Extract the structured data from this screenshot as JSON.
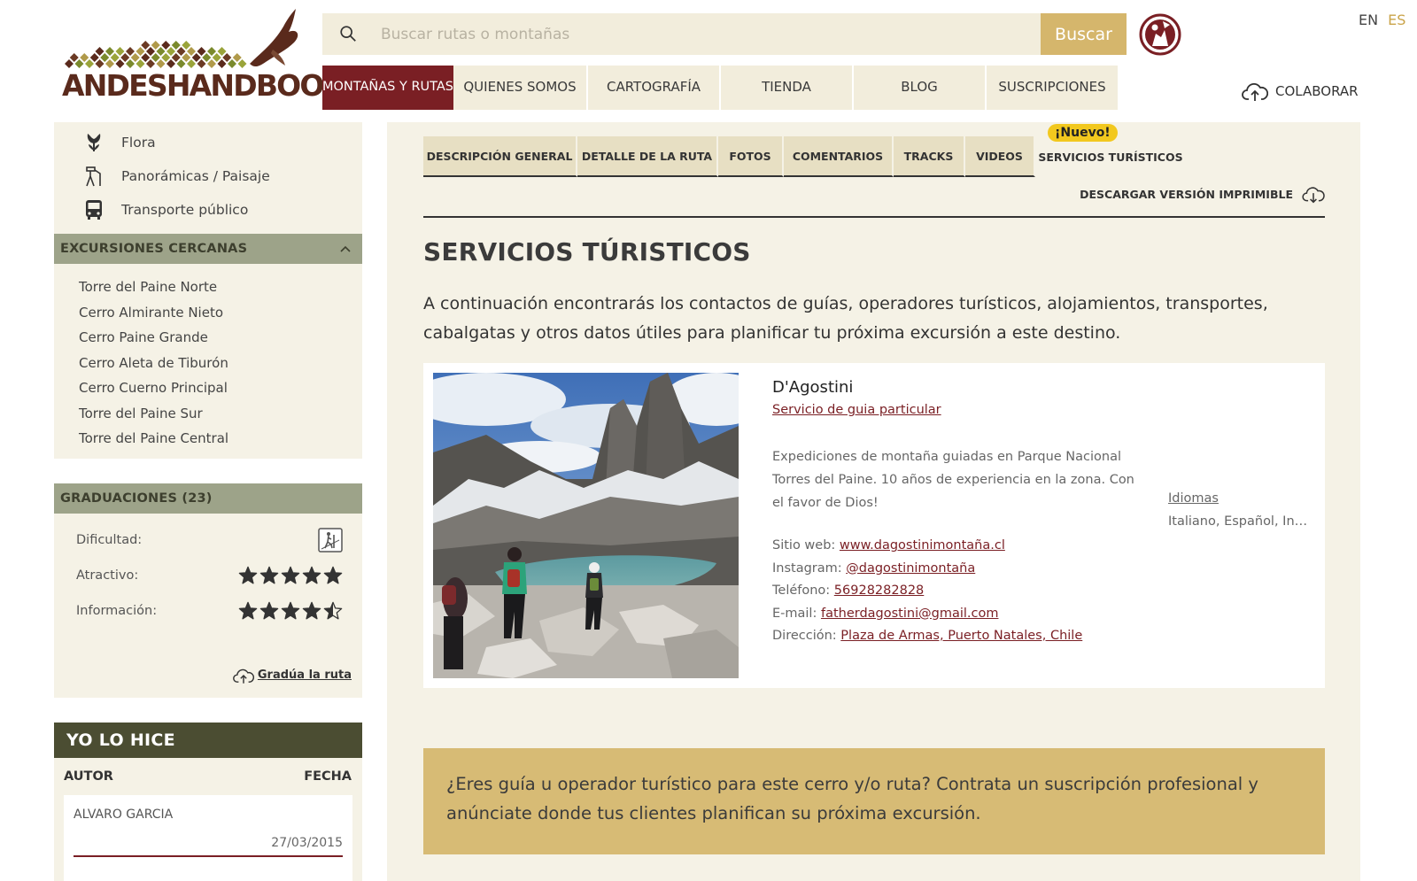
{
  "header": {
    "logo_text": "ANDESHANDBOOK",
    "search": {
      "placeholder": "Buscar rutas o montañas",
      "button_label": "Buscar"
    },
    "languages": [
      "EN",
      "ES"
    ],
    "active_language": "ES",
    "nav": [
      {
        "label": "MONTAÑAS Y RUTAS",
        "active": true
      },
      {
        "label": "QUIENES SOMOS"
      },
      {
        "label": "CARTOGRAFÍA"
      },
      {
        "label": "TIENDA"
      },
      {
        "label": "BLOG"
      },
      {
        "label": "SUSCRIPCIONES"
      }
    ],
    "collaborate_label": "COLABORAR"
  },
  "sidebar": {
    "features": [
      {
        "label": "Flora",
        "icon": "flower-icon"
      },
      {
        "label": "Panorámicas / Paisaje",
        "icon": "panorama-icon"
      },
      {
        "label": "Transporte público",
        "icon": "bus-icon"
      }
    ],
    "nearby": {
      "title": "EXCURSIONES CERCANAS",
      "items": [
        "Torre del Paine Norte",
        "Cerro Almirante Nieto",
        "Cerro Paine Grande",
        "Cerro Aleta de Tiburón",
        "Cerro Cuerno Principal",
        "Torre del Paine Sur",
        "Torre del Paine Central"
      ]
    },
    "grades": {
      "title": "GRADUACIONES (23)",
      "difficulty_label": "Dificultad:",
      "attractive_label": "Atractivo:",
      "attractive_stars": 5,
      "information_label": "Información:",
      "information_stars": 4.5,
      "link_label": "Gradúa la ruta"
    },
    "did_it": {
      "title": "YO LO HICE",
      "col_author": "AUTOR",
      "col_date": "FECHA",
      "entries": [
        {
          "author": "ALVARO GARCIA",
          "date": "27/03/2015"
        }
      ]
    }
  },
  "main": {
    "tabs": [
      "DESCRIPCIÓN GENERAL",
      "DETALLE DE LA RUTA",
      "FOTOS",
      "COMENTARIOS",
      "TRACKS",
      "VIDEOS",
      "SERVICIOS TURÍSTICOS"
    ],
    "new_badge": "¡Nuevo!",
    "download_label": "DESCARGAR VERSIÓN IMPRIMIBLE",
    "section_title": "SERVICIOS TÚRISTICOS",
    "intro": "A continuación encontrarás los contactos de guías, operadores turísticos, alojamientos, transportes, cabalgatas y otros datos útiles para planificar tu próxima excursión a este destino.",
    "service": {
      "name": "D'Agostini",
      "type": "Servicio de guia particular",
      "description": "Expediciones de montaña guiadas en Parque Nacional Torres del Paine. 10 años de experiencia en la zona. Con el favor de Dios!",
      "web_label": "Sitio web:",
      "web": "www.dagostinimontaña.cl",
      "instagram_label": "Instagram:",
      "instagram": "@dagostinimontaña",
      "phone_label": "Teléfono:",
      "phone": "56928282828",
      "email_label": "E-mail:",
      "email": "fatherdagostini@gmail.com",
      "address_label": "Dirección:",
      "address": "Plaza de Armas, Puerto Natales, Chile",
      "languages_label": "Idiomas",
      "languages": "Italiano, Español, Inglés"
    },
    "promo": "¿Eres guía u operador turístico para este cerro y/o ruta? Contrata un suscripción profesional y anúnciate donde tus clientes planifican su próxima excursión."
  },
  "colors": {
    "brand_red": "#7a1f24",
    "gold": "#d5b66c",
    "panel_bg": "#f5f2e6",
    "sidebar_head": "#9da389",
    "dark_olive": "#4b4d32",
    "badge_yellow": "#f2c81e"
  }
}
